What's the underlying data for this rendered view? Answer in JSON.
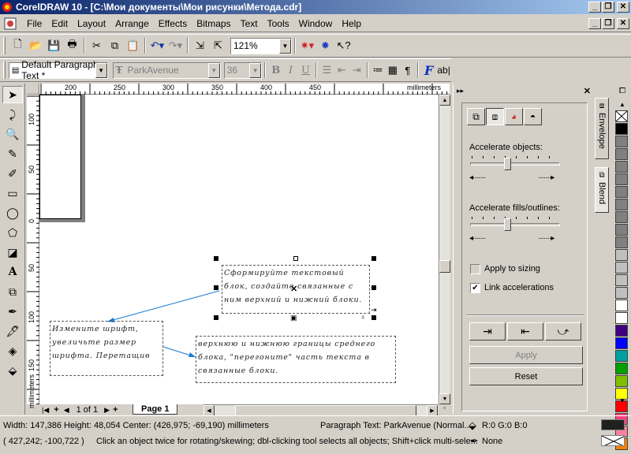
{
  "window": {
    "title": "CorelDRAW 10 - [C:\\Мои документы\\Мои рисунки\\Метода.cdr]"
  },
  "menu": [
    "File",
    "Edit",
    "Layout",
    "Arrange",
    "Effects",
    "Bitmaps",
    "Text",
    "Tools",
    "Window",
    "Help"
  ],
  "toolbar": {
    "zoom": "121%"
  },
  "textbar": {
    "style": "Default Paragraph Text *",
    "font": "ParkAvenue",
    "size": "36",
    "bold": "B",
    "italic": "I",
    "underline": "U",
    "font_icon": "F",
    "edit_icon": "ab|"
  },
  "ruler": {
    "h_labels": [
      "200",
      "250",
      "300",
      "350",
      "400",
      "450"
    ],
    "h_unit": "millimeters",
    "v_labels": [
      "100",
      "50",
      "0",
      "50",
      "100",
      "150"
    ],
    "v_unit": "millimeters"
  },
  "canvas": {
    "frame1": "Сформируйте текстовый блок, создайте связанные с ним верхний и нижний блоки.",
    "frame2": "Измените шрифт, увеличьте размер шрифта. Перетащив",
    "frame3": "верхнюю и нижнюю границы среднего блока, \"перегоните\" часть текста в связанные блоки."
  },
  "pagebar": {
    "count": "1 of 1",
    "tab": "Page 1"
  },
  "docker": {
    "accelerate_objects": "Accelerate objects:",
    "accelerate_fills": "Accelerate fills/outlines:",
    "apply_sizing": "Apply to sizing",
    "link_accel": "Link accelerations",
    "apply": "Apply",
    "reset": "Reset"
  },
  "vtabs": {
    "envelope": "Envelope",
    "blend": "Blend"
  },
  "palette": [
    "#ffffff",
    "#000000",
    "#808080",
    "#808080",
    "#808080",
    "#808080",
    "#808080",
    "#808080",
    "#808080",
    "#808080",
    "#808080",
    "#c0c0c0",
    "#c0c0c0",
    "#c0c0c0",
    "#c0c0c0",
    "#ffffff",
    "#ffffff",
    "#400080",
    "#0000ff",
    "#00a0a0",
    "#00a000",
    "#80c000",
    "#ffff00",
    "#ff0000",
    "#ff4080",
    "#ff80a0",
    "#ff8000"
  ],
  "status": {
    "dims": "Width: 147,386  Height: 48,054  Center: (426,975; -69,190)  millimeters",
    "object": "Paragraph Text: ParkAvenue (Normal...",
    "fill": "R:0 G:0 B:0",
    "coords": "( 427,242; -100,722 )",
    "hint": "Click an object twice for rotating/skewing; dbl-clicking tool selects all objects; Shift+click multi-sele...",
    "outline": "None"
  }
}
